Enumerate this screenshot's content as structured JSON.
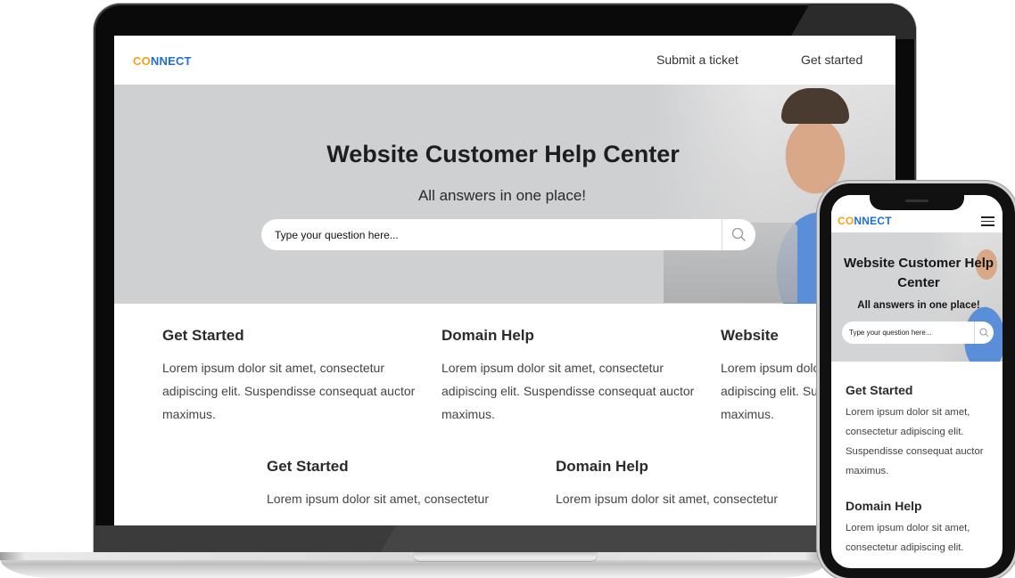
{
  "brand": {
    "logo_accent": "CO",
    "logo_rest": "NNECT",
    "logo_orange": "#f7a11a",
    "logo_blue": "#1e6fd9"
  },
  "desktop": {
    "nav": {
      "submit_ticket": "Submit a ticket",
      "get_started": "Get started"
    },
    "hero": {
      "title": "Website Customer Help Center",
      "subtitle": "All answers in one place!",
      "search_placeholder": "Type your question here...",
      "search_icon": "search-icon",
      "background": "#cfd0d2"
    },
    "cards_row1": [
      {
        "title": "Get Started",
        "body": "Lorem ipsum dolor sit amet, consectetur adipiscing elit. Suspendisse consequat auctor maximus."
      },
      {
        "title": "Domain Help",
        "body": "Lorem ipsum dolor sit amet, consectetur adipiscing elit. Suspendisse consequat auctor maximus."
      },
      {
        "title": "Website",
        "body": "Lorem ipsum dolor sit amet, consectetur adipiscing elit. Suspendisse consequat auctor maximus."
      }
    ],
    "cards_row2": [
      {
        "title": "Get Started",
        "body": "Lorem ipsum dolor sit amet, consectetur"
      },
      {
        "title": "Domain Help",
        "body": "Lorem ipsum dolor sit amet, consectetur"
      }
    ]
  },
  "mobile": {
    "menu_icon": "hamburger-icon",
    "hero": {
      "title": "Website Customer Help Center",
      "subtitle": "All answers in one place!",
      "search_placeholder": "Type your question here..."
    },
    "cards": [
      {
        "title": "Get Started",
        "body": "Lorem ipsum dolor sit amet, consectetur adipiscing elit. Suspendisse consequat auctor maximus."
      },
      {
        "title": "Domain Help",
        "body": "Lorem ipsum dolor sit amet, consectetur adipiscing elit."
      }
    ]
  }
}
